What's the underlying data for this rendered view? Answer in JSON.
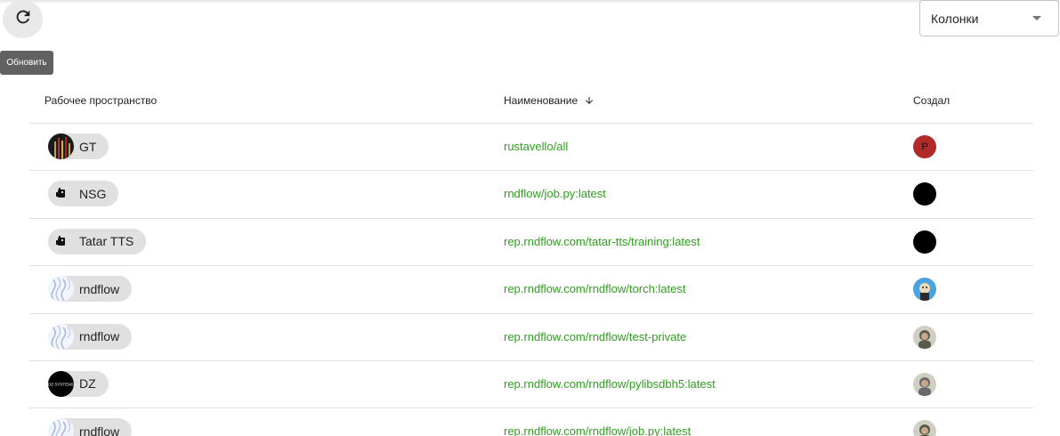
{
  "toolbar": {
    "refresh_tooltip": "Обновить",
    "columns_select": "Колонки"
  },
  "table": {
    "headers": {
      "workspace": "Рабочее пространство",
      "name": "Наименование",
      "creator": "Создал"
    },
    "sort": {
      "column": "name",
      "direction": "desc"
    },
    "rows": [
      {
        "workspace": "GT",
        "workspace_avatar": "striped-dark",
        "name": "rustavello/all",
        "creator_avatar": "letter",
        "creator_letter": "P",
        "creator_color": "#b02a2a"
      },
      {
        "workspace": "NSG",
        "workspace_avatar": "robot",
        "name": "rndflow/job.py:latest",
        "creator_avatar": "black",
        "creator_letter": "",
        "creator_color": "#000000"
      },
      {
        "workspace": "Tatar TTS",
        "workspace_avatar": "robot",
        "name": "rep.rndflow.com/tatar-tts/training:latest",
        "creator_avatar": "black",
        "creator_letter": "",
        "creator_color": "#000000"
      },
      {
        "workspace": "rndflow",
        "workspace_avatar": "waves",
        "name": "rep.rndflow.com/rndflow/torch:latest",
        "creator_avatar": "cartoon",
        "creator_letter": "",
        "creator_color": "#4aa3df"
      },
      {
        "workspace": "rndflow",
        "workspace_avatar": "waves",
        "name": "rep.rndflow.com/rndflow/test-private",
        "creator_avatar": "photo",
        "creator_letter": "",
        "creator_color": "#5a5a4a"
      },
      {
        "workspace": "DZ",
        "workspace_avatar": "dz-black",
        "name": "rep.rndflow.com/rndflow/pylibsdbh5:latest",
        "creator_avatar": "photo",
        "creator_letter": "",
        "creator_color": "#6a6a6a"
      },
      {
        "workspace": "rndflow",
        "workspace_avatar": "waves",
        "name": "rep.rndflow.com/rndflow/job.py:latest",
        "creator_avatar": "photo",
        "creator_letter": "",
        "creator_color": "#5a5a4a"
      }
    ]
  },
  "colors": {
    "link": "#2e9e1e",
    "chip": "#e0e0e0",
    "divider": "#e0e0e0"
  }
}
